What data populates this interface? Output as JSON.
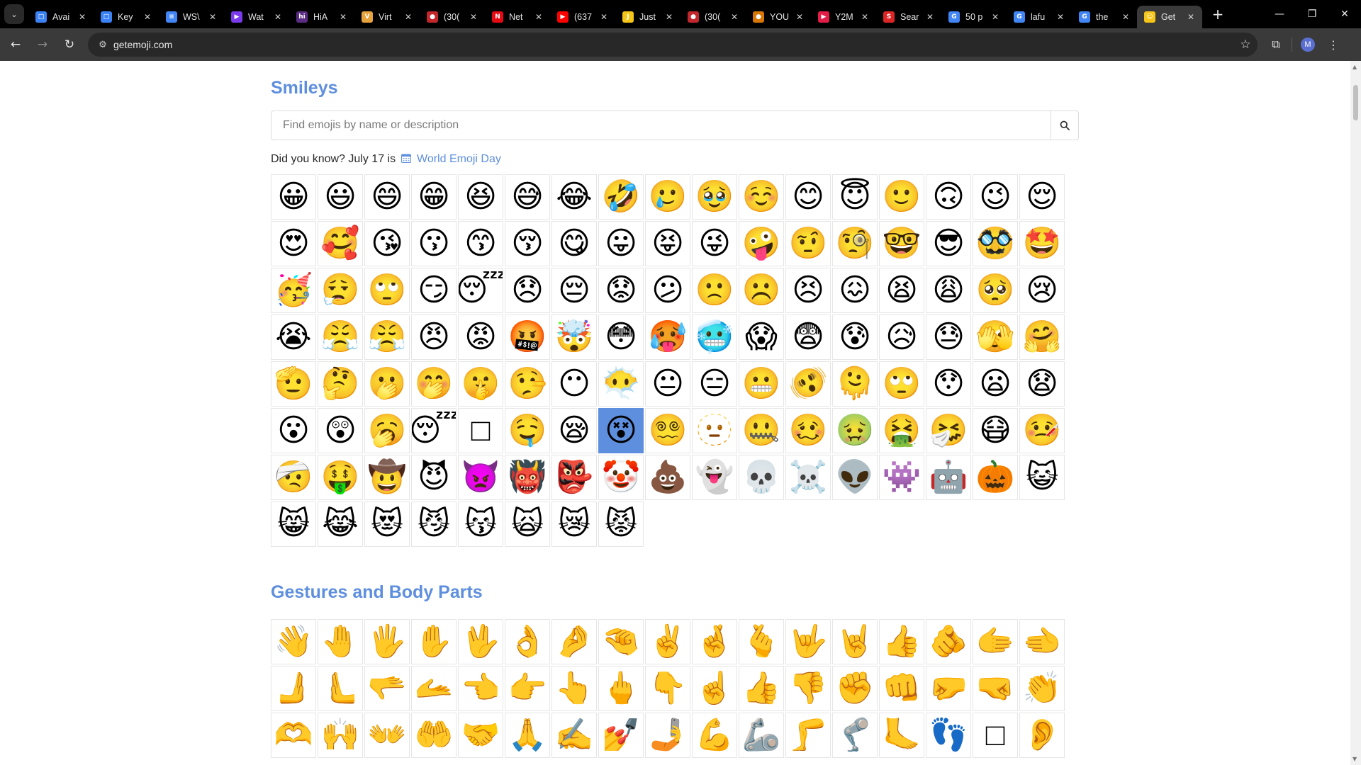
{
  "browser": {
    "tabs": [
      {
        "title": "Avai",
        "fav": "#3b82f6",
        "glyph": "□"
      },
      {
        "title": "Key",
        "fav": "#3b82f6",
        "glyph": "□"
      },
      {
        "title": "WS\\",
        "fav": "#4285f4",
        "glyph": "≡"
      },
      {
        "title": "Wat",
        "fav": "#7c3aed",
        "glyph": "▶"
      },
      {
        "title": "HiA",
        "fav": "#5b2c83",
        "glyph": "hi"
      },
      {
        "title": "Virt",
        "fav": "#e6a23c",
        "glyph": "V"
      },
      {
        "title": "(30(",
        "fav": "#c1272d",
        "glyph": "●"
      },
      {
        "title": "Net",
        "fav": "#e50914",
        "glyph": "N"
      },
      {
        "title": "(637",
        "fav": "#ff0000",
        "glyph": "▶"
      },
      {
        "title": "Just",
        "fav": "#f5c518",
        "glyph": "J"
      },
      {
        "title": "(30(",
        "fav": "#c1272d",
        "glyph": "●"
      },
      {
        "title": "YOU",
        "fav": "#d97706",
        "glyph": "●"
      },
      {
        "title": "Y2M",
        "fav": "#e11d48",
        "glyph": "▶"
      },
      {
        "title": "Sear",
        "fav": "#dc2626",
        "glyph": "S"
      },
      {
        "title": "50 p",
        "fav": "#4285f4",
        "glyph": "G"
      },
      {
        "title": "lafu",
        "fav": "#4285f4",
        "glyph": "G"
      },
      {
        "title": "the",
        "fav": "#4285f4",
        "glyph": "G"
      },
      {
        "title": "Get",
        "fav": "#f5c518",
        "glyph": "☺",
        "active": true
      }
    ],
    "new_tab": "+",
    "window_controls": [
      "—",
      "❐",
      "✕"
    ],
    "url": "getemoji.com",
    "profile_initial": "M",
    "icons": {
      "back": "←",
      "forward": "→",
      "reload": "↻",
      "site_info": "⚙",
      "bookmark": "☆",
      "extensions": "⧉",
      "menu": "⋮",
      "tab_menu": "⌄"
    }
  },
  "smileys": {
    "title": "Smileys",
    "search_placeholder": "Find emojis by name or description",
    "did_you_know_prefix": "Did you know? July 17 is",
    "did_you_know_link": "World Emoji Day",
    "emojis": [
      "😀",
      "😃",
      "😄",
      "😁",
      "😆",
      "😅",
      "😂",
      "🤣",
      "🥲",
      "🥹",
      "☺️",
      "😊",
      "😇",
      "🙂",
      "🙃",
      "😉",
      "😌",
      "😍",
      "🥰",
      "😘",
      "😗",
      "😙",
      "😚",
      "😋",
      "😛",
      "😝",
      "😜",
      "🤪",
      "🤨",
      "🧐",
      "🤓",
      "😎",
      "🥸",
      "🤩",
      "🥳",
      "😮‍💨",
      "🙄",
      "😏",
      "😴",
      "😞",
      "😔",
      "😟",
      "😕",
      "🙁",
      "☹️",
      "😣",
      "😖",
      "😫",
      "😩",
      "🥺",
      "😢",
      "😭",
      "😤",
      "😤",
      "😠",
      "😡",
      "🤬",
      "🤯",
      "😳",
      "🥵",
      "🥶",
      "😱",
      "😨",
      "😰",
      "😥",
      "😓",
      "🫣",
      "🤗",
      "🫡",
      "🤔",
      "🫢",
      "🤭",
      "🤫",
      "🤥",
      "😶",
      "😶‍🌫️",
      "😐",
      "😑",
      "😬",
      "🫨",
      "🫠",
      "🙄",
      "😯",
      "😦",
      "😧",
      "😮",
      "😲",
      "🥱",
      "😴",
      "□",
      "🤤",
      "😪",
      "😵",
      "😵‍💫",
      "🫥",
      "🤐",
      "🥴",
      "🤢",
      "🤮",
      "🤧",
      "😷",
      "🤒",
      "🤕",
      "🤑",
      "🤠",
      "😈",
      "👿",
      "👹",
      "👺",
      "🤡",
      "💩",
      "👻",
      "💀",
      "☠️",
      "👽",
      "👾",
      "🤖",
      "🎃",
      "😺",
      "😸",
      "😹",
      "😻",
      "😼",
      "😽",
      "🙀",
      "😿",
      "😾"
    ],
    "selected_index": 92
  },
  "gestures": {
    "title": "Gestures and Body Parts",
    "emojis": [
      "👋",
      "🤚",
      "🖐️",
      "✋",
      "🖖",
      "👌",
      "🤌",
      "🤏",
      "✌️",
      "🤞",
      "🫰",
      "🤟",
      "🤘",
      "👍",
      "🫵",
      "🫱",
      "🫲",
      "🫸",
      "🫷",
      "🫳",
      "🫴",
      "👈",
      "👉",
      "👆",
      "🖕",
      "👇",
      "☝️",
      "👍",
      "👎",
      "✊",
      "👊",
      "🤛",
      "🤜",
      "👏",
      "🫶",
      "🙌",
      "👐",
      "🤲",
      "🤝",
      "🙏",
      "✍️",
      "💅",
      "🤳",
      "💪",
      "🦾",
      "🦵",
      "🦿",
      "🦶",
      "👣",
      "□",
      "👂"
    ]
  }
}
